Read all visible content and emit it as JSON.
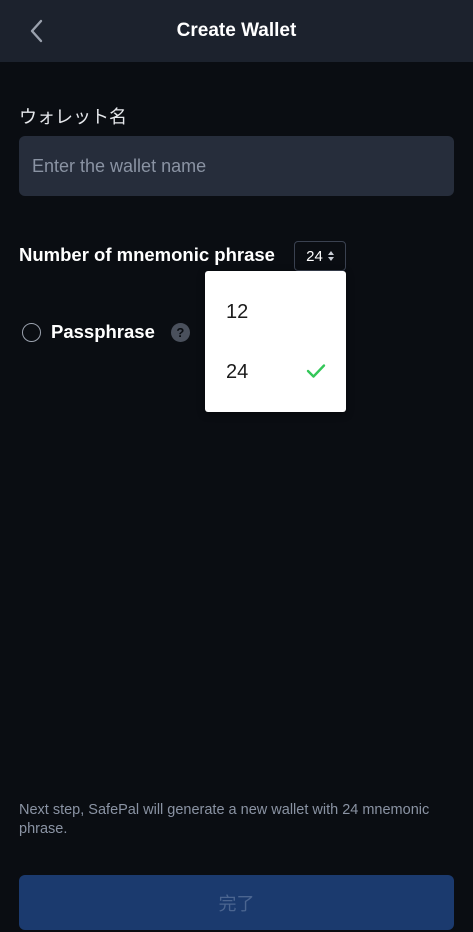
{
  "header": {
    "title": "Create Wallet",
    "back_icon": "chevron-left-icon"
  },
  "wallet_name": {
    "label": "ウォレット名",
    "placeholder": "Enter the wallet name",
    "value": ""
  },
  "mnemonic": {
    "label": "Number of mnemonic phrase",
    "selected": "24",
    "options": [
      "12",
      "24"
    ],
    "check_icon": "checkmark-icon",
    "check_color": "#34c759"
  },
  "passphrase": {
    "label": "Passphrase",
    "help_glyph": "?"
  },
  "footer": {
    "hint": "Next step, SafePal will generate a new wallet with 24 mnemonic phrase.",
    "done_label": "完了"
  },
  "colors": {
    "background": "#0a0d12",
    "header": "#1c222d",
    "input": "#262d3b",
    "button": "#1b3a6e"
  }
}
